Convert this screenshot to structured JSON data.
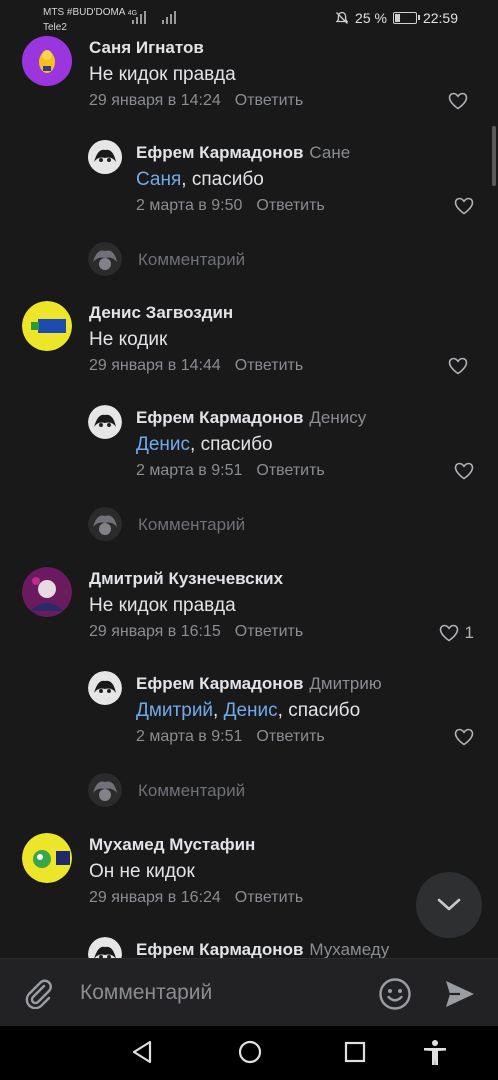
{
  "status_bar": {
    "carrier1": "MTS #BUD'DOMA",
    "network": "4G",
    "carrier2": "Tele2",
    "battery": "25 %",
    "time": "22:59",
    "battery_level": 0.25
  },
  "comments": [
    {
      "author": "Саня Игнатов",
      "text": "Не кидок правда",
      "date": "29 января в 14:24",
      "reply_label": "Ответить",
      "likes": "",
      "avatar_color": "#8f2fd6",
      "reply": {
        "author": "Ефрем Кармадонов",
        "to": "Сане",
        "mentions": [
          "Саня"
        ],
        "text_rest": ", спасибо",
        "date": "2 марта в 9:50",
        "reply_label": "Ответить"
      },
      "input_placeholder": "Комментарий"
    },
    {
      "author": "Денис Загвоздин",
      "text": "Не кодик",
      "date": "29 января в 14:44",
      "reply_label": "Ответить",
      "likes": "",
      "avatar_color": "#e8e22a",
      "reply": {
        "author": "Ефрем Кармадонов",
        "to": "Денису",
        "mentions": [
          "Денис"
        ],
        "text_rest": ", спасибо",
        "date": "2 марта в 9:51",
        "reply_label": "Ответить"
      },
      "input_placeholder": "Комментарий"
    },
    {
      "author": "Дмитрий Кузнечевских",
      "text": "Не кидок правда",
      "date": "29 января в 16:15",
      "reply_label": "Ответить",
      "likes": "1",
      "avatar_color": "#7a1f6e",
      "reply": {
        "author": "Ефрем Кармадонов",
        "to": "Дмитрию",
        "mentions": [
          "Дмитрий",
          "Денис"
        ],
        "text_rest": ", спасибо",
        "date": "2 марта в 9:51",
        "reply_label": "Ответить"
      },
      "input_placeholder": "Комментарий"
    },
    {
      "author": "Мухамед Мустафин",
      "text": "Он не кидок",
      "date": "29 января в 16:24",
      "reply_label": "Ответить",
      "likes": "",
      "avatar_color": "#e8e22a",
      "reply": {
        "author": "Ефрем Кармадонов",
        "to": "Мухамеду"
      }
    }
  ],
  "composer": {
    "placeholder": "Комментарий"
  },
  "colors": {
    "background": "#19191a",
    "mention": "#71aaeb",
    "secondary_text": "#8a8d91"
  }
}
